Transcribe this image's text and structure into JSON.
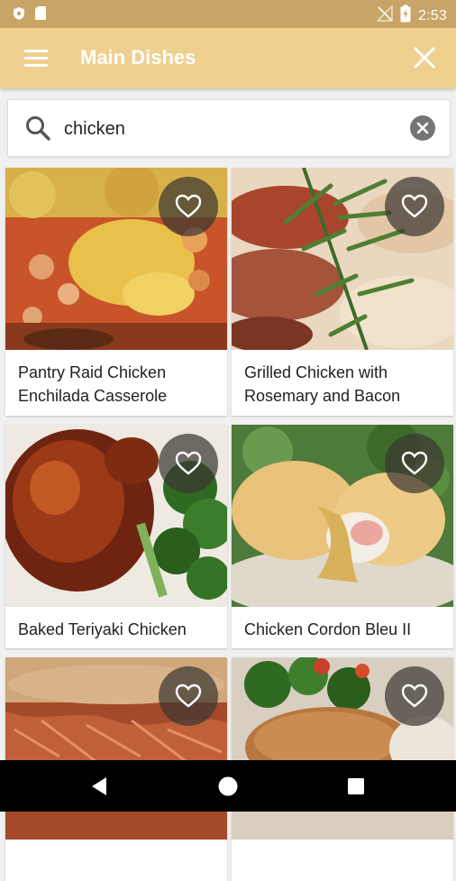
{
  "status_bar": {
    "time": "2:53"
  },
  "app_bar": {
    "title": "Main Dishes"
  },
  "search": {
    "value": "chicken"
  },
  "recipes": [
    {
      "title": "Pantry Raid Chicken Enchilada Casserole"
    },
    {
      "title": "Grilled Chicken with Rosemary and Bacon"
    },
    {
      "title": "Baked Teriyaki Chicken"
    },
    {
      "title": "Chicken Cordon Bleu II"
    },
    {
      "title": ""
    },
    {
      "title": ""
    }
  ],
  "colors": {
    "status_bar": "#c8a566",
    "app_bar": "#f0d08f",
    "background": "#f0f0f0"
  }
}
